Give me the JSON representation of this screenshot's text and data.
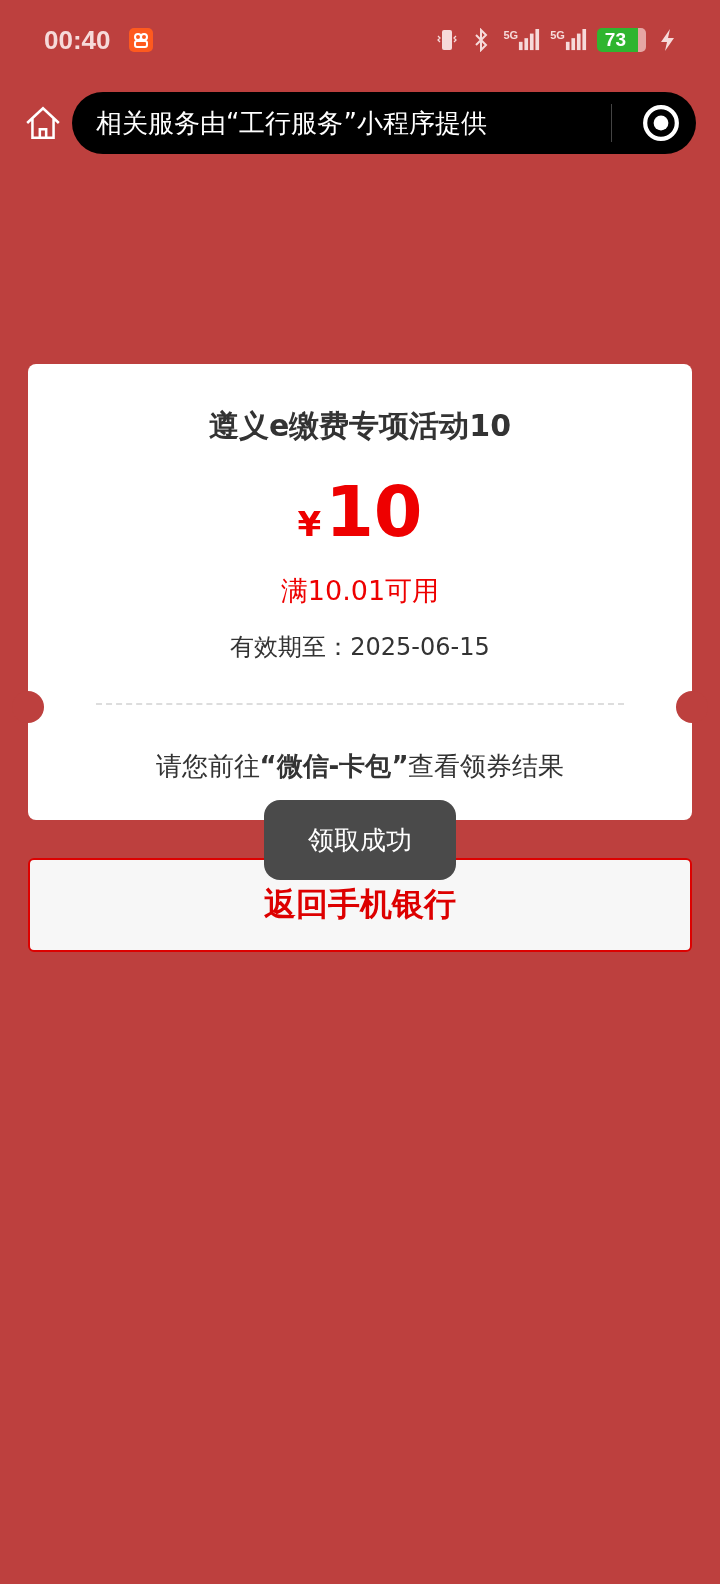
{
  "status_bar": {
    "time": "00:40",
    "networks": [
      "5G",
      "5G"
    ],
    "battery": "73",
    "charging": true
  },
  "nav": {
    "title": "相关服务由“工行服务”小程序提供"
  },
  "coupon": {
    "title": "遵义e缴费专项活动10",
    "currency": "¥",
    "amount": "10",
    "condition": "满10.01可用",
    "validity": "有效期至：2025-06-15",
    "note": "请您前往**“微信-卡包”**查看领券结果"
  },
  "button": {
    "label": "返回手机银行"
  },
  "toast": {
    "text": "领取成功"
  }
}
